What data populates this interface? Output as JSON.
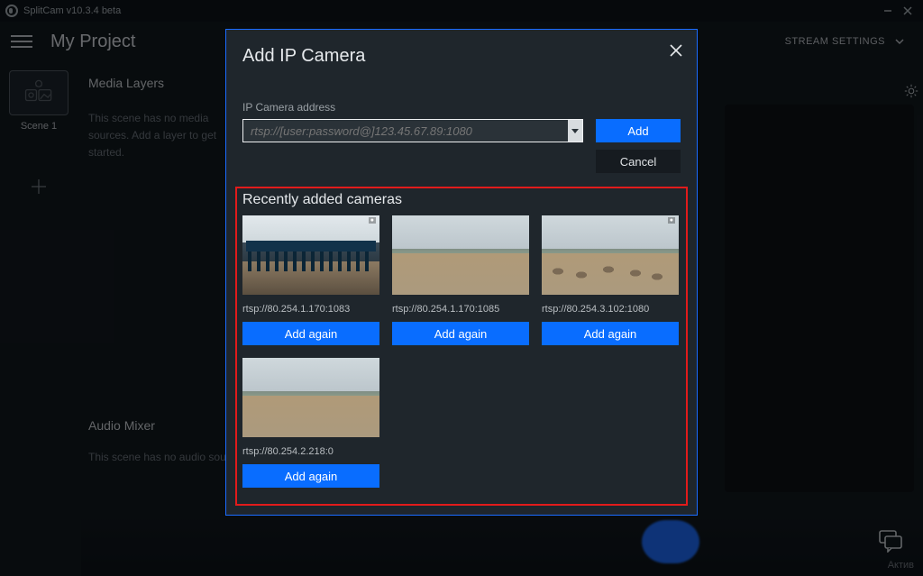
{
  "titlebar": {
    "app_name": "SplitCam v10.3.4 beta"
  },
  "header": {
    "project_title": "My Project",
    "stream_settings_label": "STREAM SETTINGS"
  },
  "scenes": {
    "items": [
      {
        "label": "Scene 1"
      }
    ]
  },
  "media_layers": {
    "title": "Media Layers",
    "empty_text": "This scene has no media sources. Add a layer to get started."
  },
  "audio_mixer": {
    "title": "Audio Mixer",
    "empty_text": "This scene has no audio sources."
  },
  "dialog": {
    "title": "Add IP Camera",
    "field_label": "IP Camera address",
    "placeholder": "rtsp://[user:password@]123.45.67.89:1080",
    "add_label": "Add",
    "cancel_label": "Cancel",
    "recent_title": "Recently added cameras",
    "add_again_label": "Add again",
    "cameras": [
      {
        "url": "rtsp://80.254.1.170:1083"
      },
      {
        "url": "rtsp://80.254.1.170:1085"
      },
      {
        "url": "rtsp://80.254.3.102:1080"
      },
      {
        "url": "rtsp://80.254.2.218:0"
      }
    ]
  },
  "bottom_right_text": "Актив"
}
